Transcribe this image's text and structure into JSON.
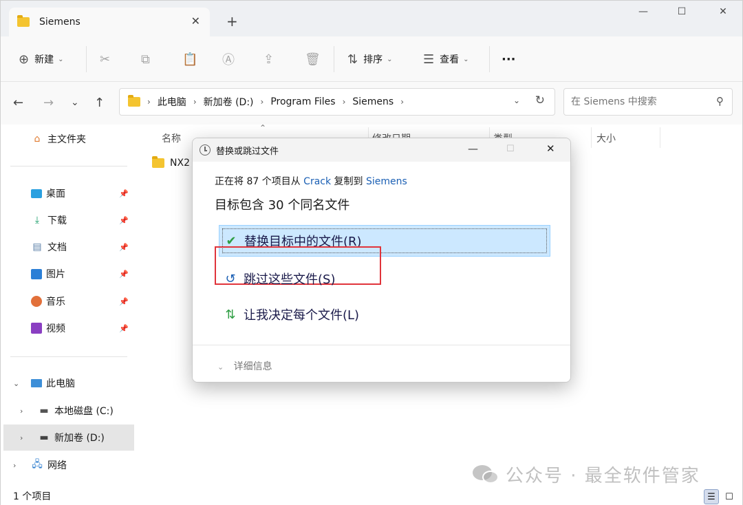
{
  "window": {
    "tab_title": "Siemens",
    "new_tab": "+",
    "minimize": "—",
    "maximize": "☐",
    "close": "✕"
  },
  "toolbar": {
    "new_label": "新建",
    "sort_label": "排序",
    "view_label": "查看",
    "more_label": "···"
  },
  "address": {
    "crumbs": [
      "此电脑",
      "新加卷 (D:)",
      "Program Files",
      "Siemens"
    ],
    "search_placeholder": "在 Siemens 中搜索"
  },
  "sidebar": {
    "home": "主文件夹",
    "quick": [
      "桌面",
      "下载",
      "文档",
      "图片",
      "音乐",
      "视频"
    ],
    "this_pc": "此电脑",
    "drives": [
      "本地磁盘 (C:)",
      "新加卷 (D:)"
    ],
    "network": "网络"
  },
  "columns": {
    "name": "名称",
    "modified": "修改日期",
    "type": "类型",
    "size": "大小"
  },
  "files": [
    {
      "name": "NX2"
    }
  ],
  "status": {
    "count": "1 个项目"
  },
  "dialog": {
    "title": "替换或跳过文件",
    "line1_prefix": "正在将 87 个项目从 ",
    "line1_source": "Crack",
    "line1_mid": " 复制到 ",
    "line1_dest": "Siemens",
    "line2": "目标包含 30 个同名文件",
    "options": [
      "替换目标中的文件(R)",
      "跳过这些文件(S)",
      "让我决定每个文件(L)"
    ],
    "details": "详细信息"
  },
  "watermark": {
    "text": "公众号 · 最全软件管家"
  },
  "colors": {
    "accent": "#1a5fb4",
    "highlight": "#cce8ff",
    "red_box": "#e0333a",
    "folder": "#f4c430"
  }
}
